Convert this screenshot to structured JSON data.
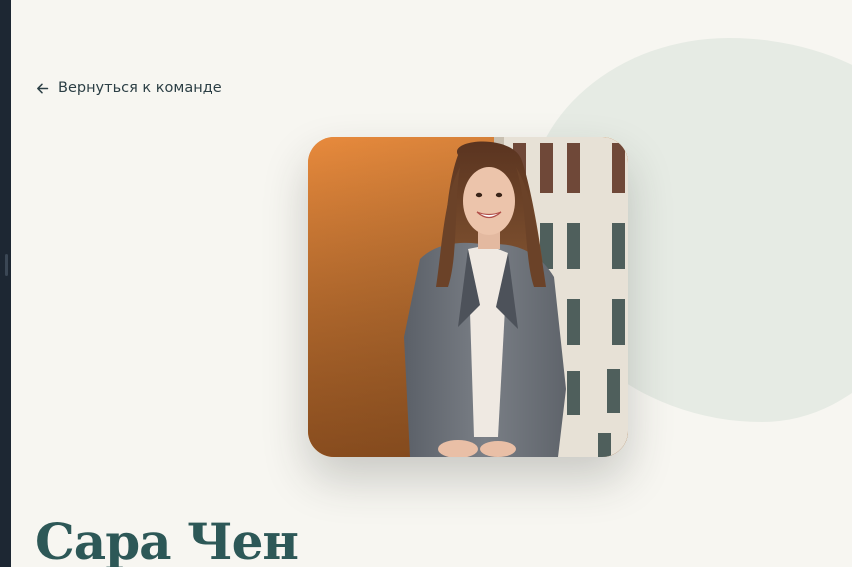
{
  "nav": {
    "back_label": "Вернуться к команде",
    "back_icon": "arrow-left-icon"
  },
  "profile": {
    "name": "Сара Чен"
  },
  "colors": {
    "background": "#f7f6f1",
    "blob": "#e6ebe4",
    "heading": "#2d5857",
    "link": "#2c3f45",
    "rail": "#1d2733"
  }
}
